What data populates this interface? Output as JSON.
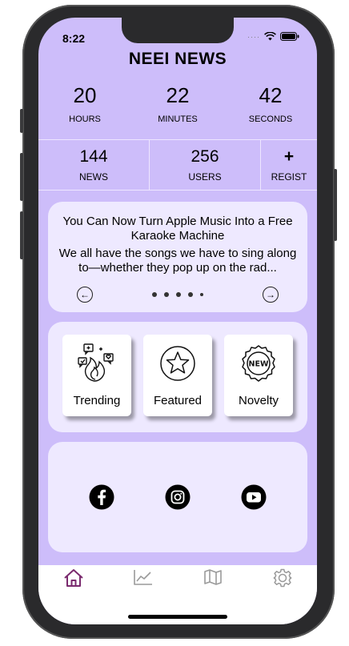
{
  "status": {
    "time": "8:22"
  },
  "app": {
    "title": "NEEI NEWS"
  },
  "countdown": [
    {
      "value": "20",
      "label": "HOURS"
    },
    {
      "value": "22",
      "label": "MINUTES"
    },
    {
      "value": "42",
      "label": "SECONDS"
    }
  ],
  "stats": {
    "news": {
      "value": "144",
      "label": "NEWS"
    },
    "users": {
      "value": "256",
      "label": "USERS"
    },
    "register": {
      "value": "+",
      "label": "REGIST"
    }
  },
  "news_card": {
    "headline": "You Can Now Turn Apple Music Into a Free Karaoke Machine",
    "excerpt": "We all have the songs we have to sing along to—whether they pop up on the rad...",
    "active_slide": 1,
    "slide_count": 5
  },
  "categories": [
    {
      "label": "Trending",
      "icon": "trending-icon"
    },
    {
      "label": "Featured",
      "icon": "star-icon"
    },
    {
      "label": "Novelty",
      "icon": "new-badge-icon"
    }
  ],
  "social": [
    "facebook-icon",
    "instagram-icon",
    "youtube-icon"
  ],
  "tabs": [
    {
      "icon": "home-icon",
      "active": true
    },
    {
      "icon": "chart-icon",
      "active": false
    },
    {
      "icon": "map-icon",
      "active": false
    },
    {
      "icon": "settings-icon",
      "active": false
    }
  ],
  "colors": {
    "background": "#cdbdfa",
    "card": "#eee9ff",
    "active_tab": "#7a2a6e",
    "inactive_tab": "#9a9a9a"
  }
}
